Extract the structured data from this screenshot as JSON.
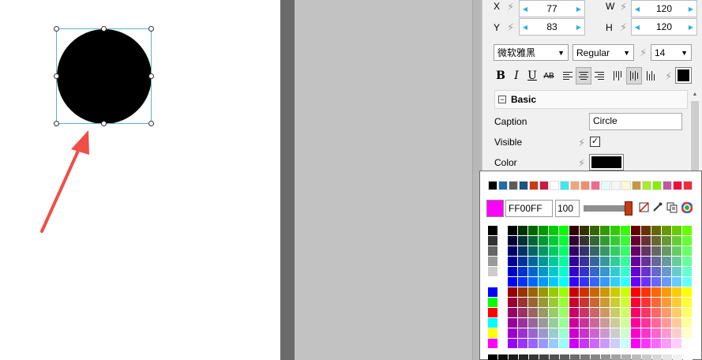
{
  "geometry": {
    "x_label": "X",
    "x_value": "77",
    "y_label": "Y",
    "y_value": "83",
    "w_label": "W",
    "w_value": "120",
    "h_label": "H",
    "h_value": "120"
  },
  "font": {
    "family": "微软雅黑",
    "style": "Regular",
    "size": "14"
  },
  "format_buttons": {
    "bold": "B",
    "italic": "I",
    "underline": "U",
    "strike": "AB"
  },
  "section": {
    "title": "Basic",
    "collapse_glyph": "−"
  },
  "props": {
    "caption_label": "Caption",
    "caption_value": "Circle",
    "visible_label": "Visible",
    "visible_checked": "✓",
    "color_label": "Color"
  },
  "picker": {
    "hex": "FF00FF",
    "alpha": "100",
    "current_color": "#ff00ff"
  },
  "colors": {
    "accent": "#2fb0d6",
    "arrow": "#f04e48",
    "selection": "#5bb3c9"
  },
  "icons": [
    "lightning-icon",
    "no-fill-icon",
    "eyedropper-icon",
    "copy-icon",
    "color-wheel-icon",
    "bold-icon",
    "italic-icon",
    "underline-icon",
    "strikethrough-icon",
    "align-left-icon",
    "align-center-icon",
    "align-right-icon"
  ]
}
